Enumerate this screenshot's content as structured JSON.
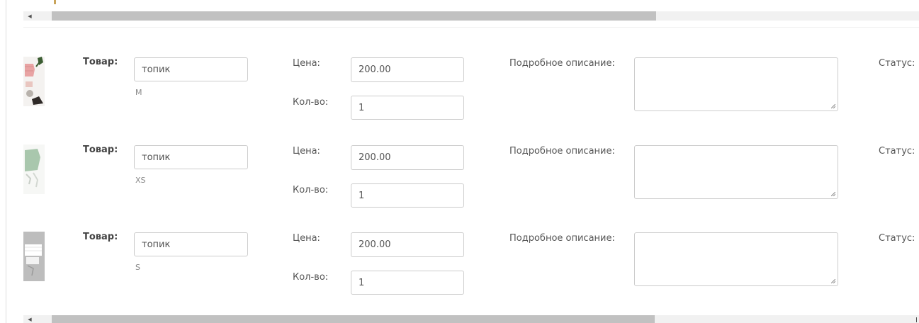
{
  "labels": {
    "product": "Товар:",
    "price": "Цена:",
    "quantity": "Кол-во:",
    "description": "Подробное описание:",
    "status": "Статус:"
  },
  "scrollbar": {
    "left_arrow_icon": "triangle-left-icon"
  },
  "items": [
    {
      "name": "топик",
      "size": "M",
      "price": "200.00",
      "quantity": "1",
      "description": "",
      "image_colors": {
        "bg": "#f4f2f0",
        "garment": "#e8a3a3",
        "accent": "#3b5d32"
      }
    },
    {
      "name": "топик",
      "size": "XS",
      "price": "200.00",
      "quantity": "1",
      "description": "",
      "image_colors": {
        "bg": "#f6f7f5",
        "garment": "#a9c7ad",
        "accent": "#c9cfc8"
      }
    },
    {
      "name": "топик",
      "size": "S",
      "price": "200.00",
      "quantity": "1",
      "description": "",
      "image_colors": {
        "bg": "#bdbdbd",
        "garment": "#ffffff",
        "accent": "#9a9a9a"
      }
    }
  ],
  "colors": {
    "accent": "#c9a45b",
    "input_border": "#cccccc",
    "scroll_thumb": "#c1c1c1",
    "scroll_track": "#f1f1f1"
  }
}
